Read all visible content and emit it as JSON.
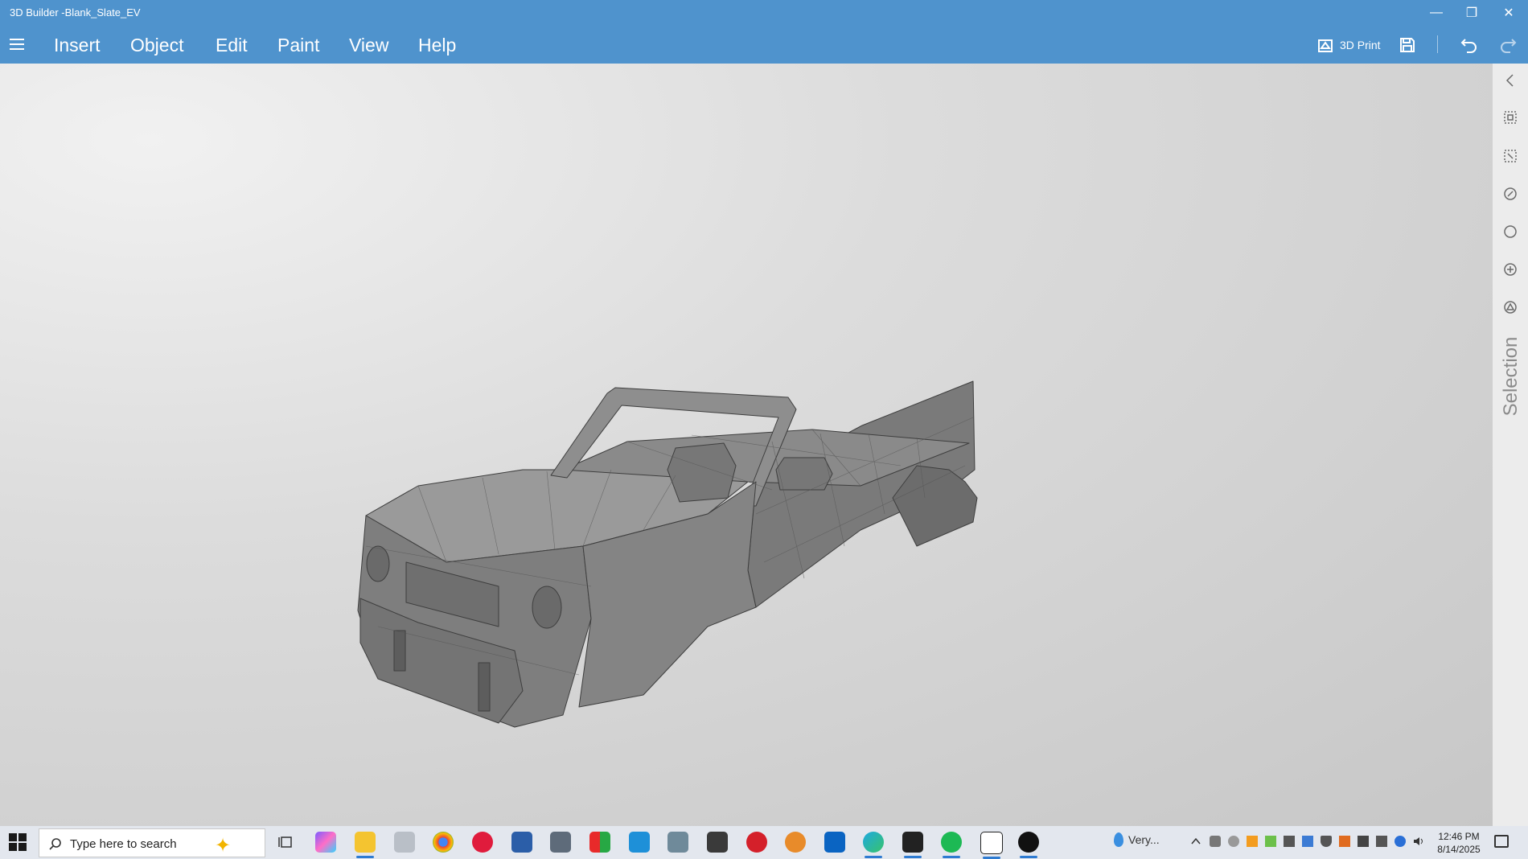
{
  "window": {
    "title": "3D Builder -Blank_Slate_EV"
  },
  "menu": {
    "items": [
      "Insert",
      "Object",
      "Edit",
      "Paint",
      "View",
      "Help"
    ]
  },
  "toolbar": {
    "print_label": "3D Print"
  },
  "rail": {
    "label": "Selection"
  },
  "taskbar": {
    "search_placeholder": "Type here to search",
    "weather": "Very...",
    "time": "12:46 PM",
    "date": "8/14/2025"
  },
  "colors": {
    "accent": "#4f93cd",
    "taskbar": "#e3e7ee",
    "rail": "#ececec"
  }
}
